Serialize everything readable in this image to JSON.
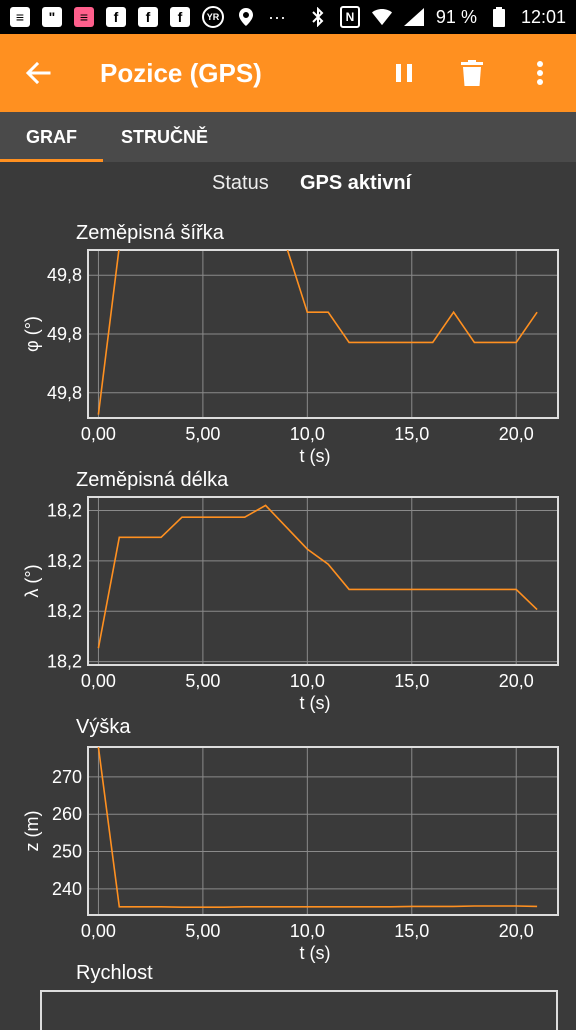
{
  "statusbar": {
    "left_icons": [
      "message-icon",
      "chat-icon",
      "pink-message-icon",
      "facebook-icon",
      "facebook-icon",
      "facebook-icon",
      "yr-icon",
      "location-icon",
      "more-icon"
    ],
    "more_text": "···",
    "battery_text": "91 %",
    "time": "12:01"
  },
  "appbar": {
    "title": "Pozice (GPS)"
  },
  "tabs": [
    {
      "label": "GRAF",
      "active": true
    },
    {
      "label": "STRUČNĚ",
      "active": false
    }
  ],
  "status": {
    "label": "Status",
    "value": "GPS aktivní"
  },
  "colors": {
    "accent": "#ff9020",
    "background": "#3a3a3a",
    "line": "#ff9020",
    "grid": "#8a8a8a",
    "frame": "#dddddd"
  },
  "chart_data": [
    {
      "type": "line",
      "title": "Zeměpisná šířka",
      "xlabel": "t (s)",
      "ylabel": "φ (°)",
      "xlim": [
        -0.5,
        22
      ],
      "ylim": [
        0,
        1
      ],
      "x_ticks": [
        0,
        5,
        10,
        15,
        20
      ],
      "x_tick_labels": [
        "0,00",
        "5,00",
        "10,0",
        "15,0",
        "20,0"
      ],
      "y_ticks": [
        0.85,
        0.5,
        0.15
      ],
      "y_tick_labels": [
        "49,8",
        "49,8",
        "49,8"
      ],
      "grid": true,
      "series": [
        {
          "x": [
            0,
            1,
            9,
            10,
            11,
            12,
            13,
            14,
            15,
            16,
            17,
            18,
            19,
            20,
            21
          ],
          "y": [
            0.02,
            1.02,
            1.02,
            0.63,
            0.63,
            0.45,
            0.45,
            0.45,
            0.45,
            0.45,
            0.63,
            0.45,
            0.45,
            0.45,
            0.63
          ]
        }
      ]
    },
    {
      "type": "line",
      "title": "Zeměpisná délka",
      "xlabel": "t (s)",
      "ylabel": "λ (°)",
      "xlim": [
        -0.5,
        22
      ],
      "ylim": [
        0,
        1
      ],
      "x_ticks": [
        0,
        5,
        10,
        15,
        20
      ],
      "x_tick_labels": [
        "0,00",
        "5,00",
        "10,0",
        "15,0",
        "20,0"
      ],
      "y_ticks": [
        0.92,
        0.62,
        0.32,
        0.02
      ],
      "y_tick_labels": [
        "18,2",
        "18,2",
        "18,2",
        "18,2"
      ],
      "grid": true,
      "series": [
        {
          "x": [
            0,
            1,
            2,
            3,
            4,
            5,
            6,
            7,
            8,
            9,
            10,
            11,
            12,
            13,
            14,
            15,
            16,
            17,
            18,
            19,
            20,
            21
          ],
          "y": [
            0.1,
            0.76,
            0.76,
            0.76,
            0.88,
            0.88,
            0.88,
            0.88,
            0.95,
            0.82,
            0.69,
            0.6,
            0.45,
            0.45,
            0.45,
            0.45,
            0.45,
            0.45,
            0.45,
            0.45,
            0.45,
            0.33
          ]
        }
      ]
    },
    {
      "type": "line",
      "title": "Výška",
      "xlabel": "t (s)",
      "ylabel": "z (m)",
      "xlim": [
        -0.5,
        22
      ],
      "ylim": [
        233,
        278
      ],
      "x_ticks": [
        0,
        5,
        10,
        15,
        20
      ],
      "x_tick_labels": [
        "0,00",
        "5,00",
        "10,0",
        "15,0",
        "20,0"
      ],
      "y_ticks": [
        270,
        260,
        250,
        240
      ],
      "y_tick_labels": [
        "270",
        "260",
        "250",
        "240"
      ],
      "grid": true,
      "series": [
        {
          "x": [
            0,
            1,
            2,
            3,
            4,
            5,
            6,
            7,
            8,
            9,
            10,
            11,
            12,
            13,
            14,
            15,
            16,
            17,
            18,
            19,
            20,
            21
          ],
          "y": [
            278,
            235.2,
            235.2,
            235.2,
            235.1,
            235.1,
            235.1,
            235.2,
            235.2,
            235.2,
            235.2,
            235.2,
            235.2,
            235.2,
            235.2,
            235.3,
            235.3,
            235.3,
            235.4,
            235.4,
            235.4,
            235.3
          ]
        }
      ]
    }
  ],
  "rychlost": {
    "title": "Rychlost"
  }
}
